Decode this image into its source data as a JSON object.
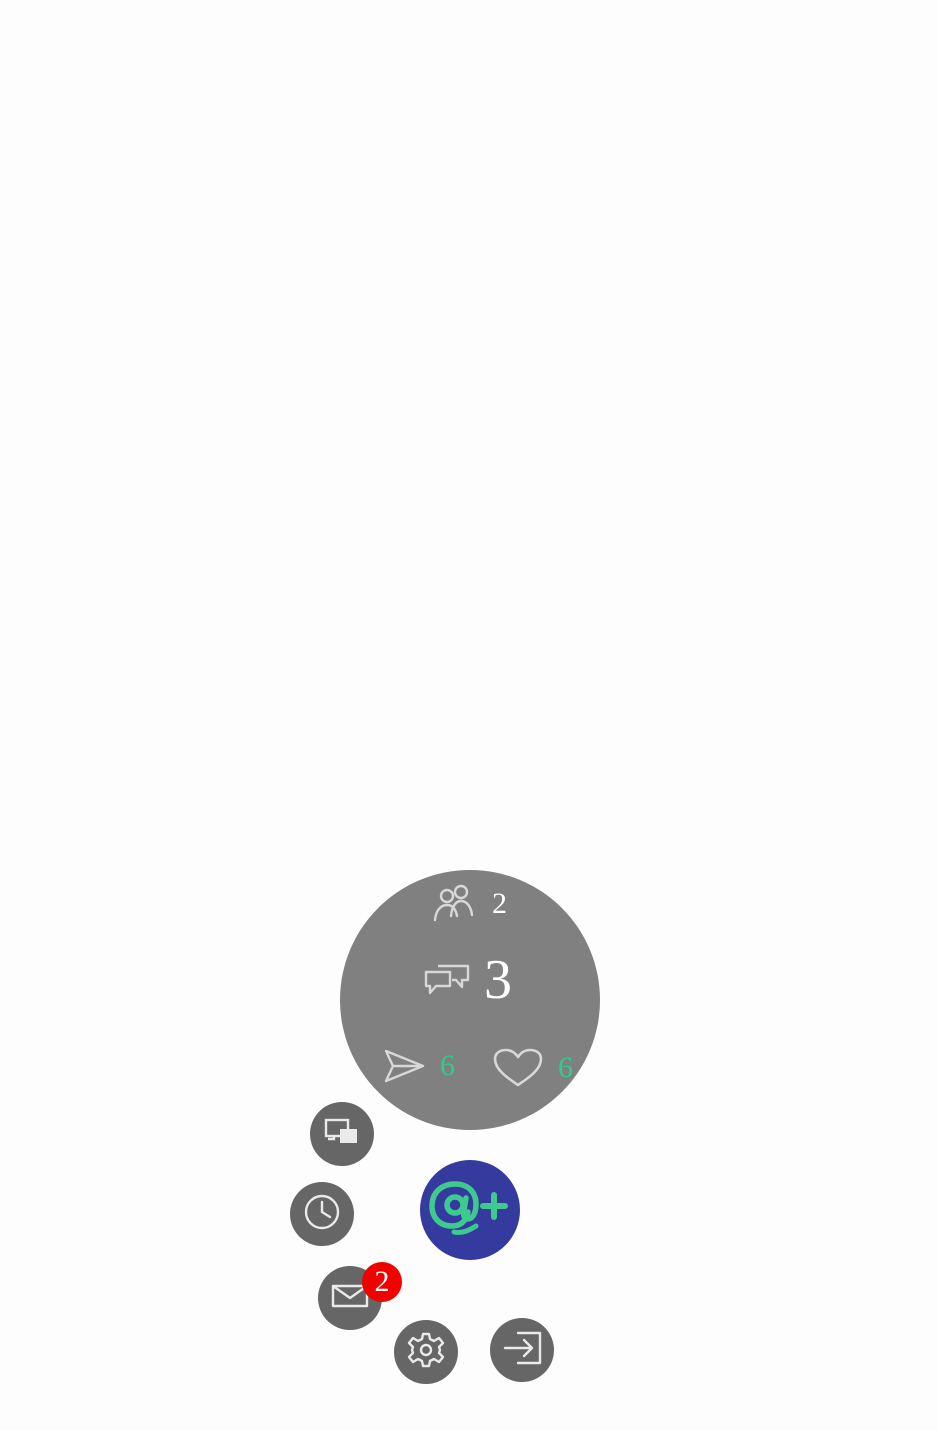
{
  "stats": {
    "people_count": "2",
    "chats_count": "3",
    "sent_count": "6",
    "liked_count": "6"
  },
  "buttons": {
    "windows_icon": "windows-icon",
    "history_icon": "clock-icon",
    "mail_icon": "envelope-icon",
    "settings_icon": "gear-icon",
    "logout_icon": "exit-icon",
    "main_icon": "at-plus-icon"
  },
  "mail_badge": "2",
  "colors": {
    "stats_bg": "#808080",
    "button_bg": "#666666",
    "main_bg": "#353b9e",
    "accent_green": "#2ecc8e",
    "badge_red": "#f20000"
  }
}
